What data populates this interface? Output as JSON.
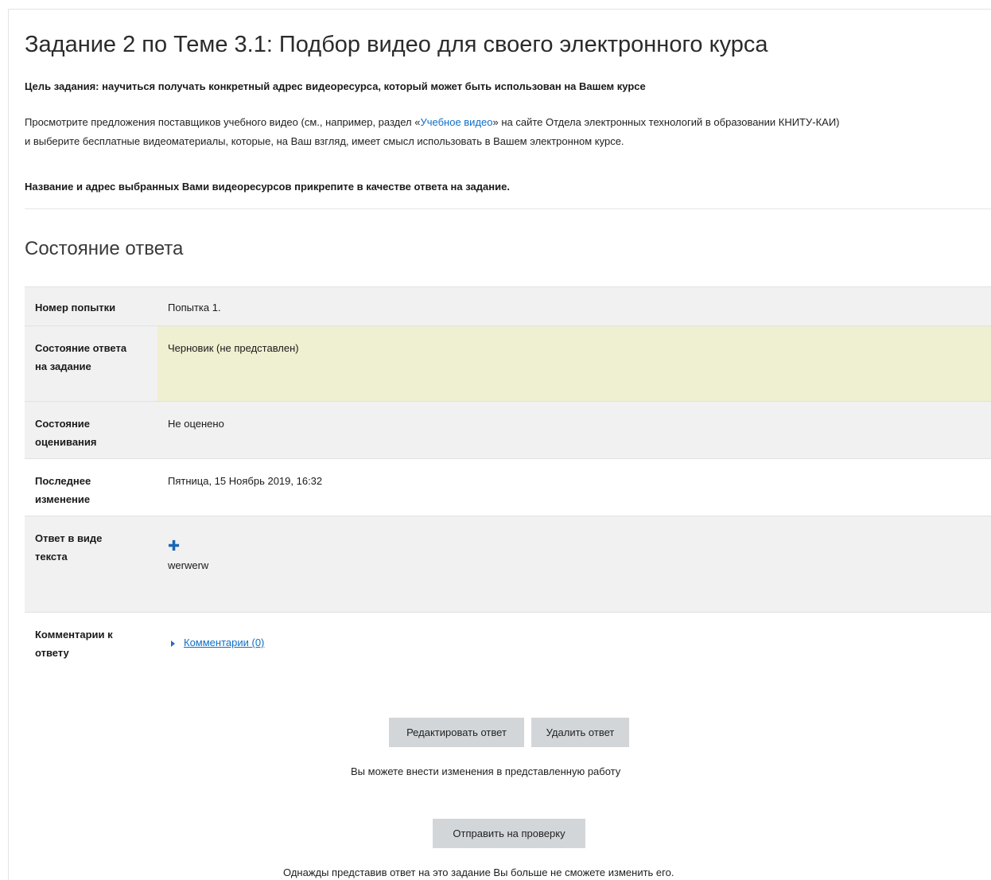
{
  "assignment": {
    "title": "Задание 2 по Теме 3.1: Подбор видео для своего электронного курса",
    "goal": "Цель задания: научиться получать конкретный адрес видеоресурса, который может быть использован на Вашем курсе",
    "para_before_link": "Просмотрите предложения поставщиков учебного видео (см., например, раздел «",
    "link_text": "Учебное видео",
    "para_after_link": "»  на сайте Отдела электронных технологий в образовании КНИТУ-КАИ)",
    "para_line2": "и выберите бесплатные видеоматериалы, которые, на Ваш взгляд, имеет смысл использовать в Вашем электронном курсе.",
    "submit_instruction": "Название и адрес выбранных Вами видеоресурсов прикрепите в качестве ответа на задание."
  },
  "status": {
    "heading": "Состояние ответа",
    "rows": [
      {
        "label": "Номер попытки",
        "value": "Попытка 1."
      },
      {
        "label": "Состояние ответа на задание",
        "value": "Черновик (не представлен)"
      },
      {
        "label": "Состояние оценивания",
        "value": "Не оценено"
      },
      {
        "label": "Последнее изменение",
        "value": "Пятница, 15 Ноябрь 2019, 16:32"
      },
      {
        "label": "Ответ в виде текста",
        "value": "werwerw"
      },
      {
        "label": "Комментарии к ответу",
        "value": "Комментарии (0)"
      }
    ]
  },
  "actions": {
    "edit_label": "Редактировать ответ",
    "delete_label": "Удалить ответ",
    "edit_note": "Вы можете внести изменения в представленную работу",
    "submit_label": "Отправить на проверку",
    "submit_note": "Однажды представив ответ на это задание Вы больше не сможете изменить его."
  },
  "icons": {
    "expand": "plus-icon",
    "collapse": "triangle-right-icon"
  },
  "colors": {
    "link": "#0f6fc6",
    "draft_highlight": "#efefd1",
    "button": "#d3d6d9"
  }
}
